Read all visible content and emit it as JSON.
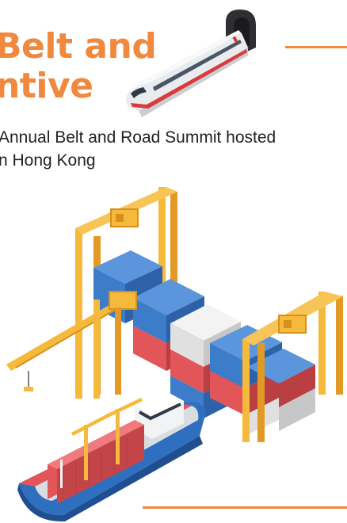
{
  "header": {
    "title_line1": "Belt and",
    "title_line2": "ntive",
    "subtitle_line1": "Annual Belt and Road Summit hosted",
    "subtitle_line2": "n Hong Kong"
  },
  "colors": {
    "accent": "#f0883e",
    "crane": "#f5b93b",
    "container_blue": "#3d7cc9",
    "container_red": "#e2565a",
    "container_white": "#e8e8e8",
    "hull": "#2f6fc0"
  },
  "illustrations": [
    "high-speed-train",
    "port-gantry-cranes",
    "container-stacks",
    "container-ship"
  ]
}
